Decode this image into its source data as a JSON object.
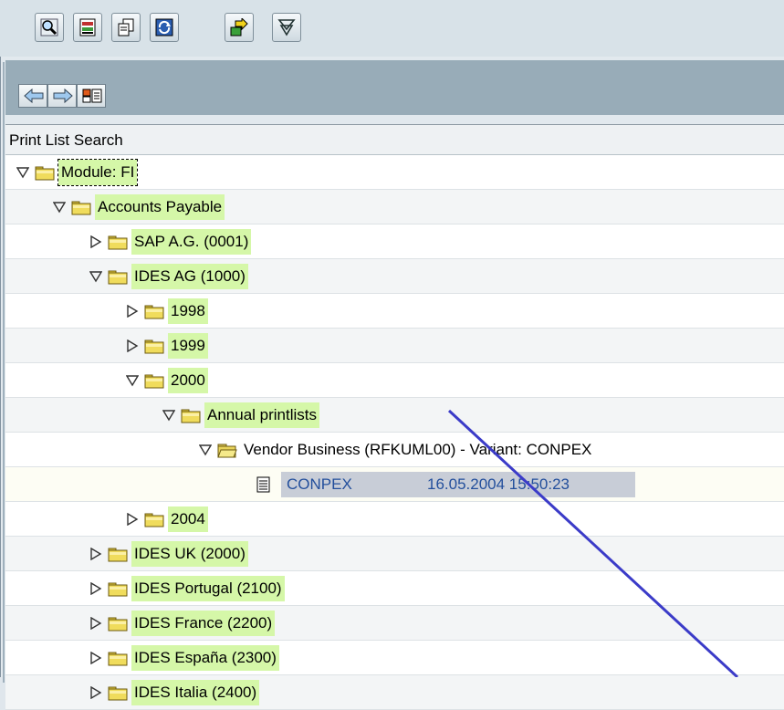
{
  "panel": {
    "header_title": "Print List Search"
  },
  "tree": [
    {
      "level": 0,
      "state": "expanded",
      "icon": "folder-icon",
      "label": "Module: FI",
      "focused": true
    },
    {
      "level": 1,
      "state": "expanded",
      "icon": "folder-icon",
      "label": "Accounts Payable"
    },
    {
      "level": 2,
      "state": "collapsed",
      "icon": "folder-icon",
      "label": "SAP A.G. (0001)"
    },
    {
      "level": 2,
      "state": "expanded",
      "icon": "folder-icon",
      "label": "IDES AG (1000)"
    },
    {
      "level": 3,
      "state": "collapsed",
      "icon": "folder-icon",
      "label": "1998"
    },
    {
      "level": 3,
      "state": "collapsed",
      "icon": "folder-icon",
      "label": "1999"
    },
    {
      "level": 3,
      "state": "expanded",
      "icon": "folder-icon",
      "label": "2000"
    },
    {
      "level": 4,
      "state": "expanded",
      "icon": "folder-icon",
      "label": "Annual printlists"
    },
    {
      "level": 5,
      "state": "expanded",
      "icon": "open-folder-icon",
      "label": "Vendor Business (RFKUML00)  -  Variant: CONPEX"
    },
    {
      "level": 6,
      "state": "leaf",
      "icon": "document-icon",
      "name": "CONPEX",
      "timestamp": "16.05.2004 15:50:23",
      "selected": true
    },
    {
      "level": 3,
      "state": "collapsed",
      "icon": "folder-icon",
      "label": "2004"
    },
    {
      "level": 2,
      "state": "collapsed",
      "icon": "folder-icon",
      "label": "IDES UK (2000)"
    },
    {
      "level": 2,
      "state": "collapsed",
      "icon": "folder-icon",
      "label": "IDES Portugal (2100)"
    },
    {
      "level": 2,
      "state": "collapsed",
      "icon": "folder-icon",
      "label": "IDES France (2200)"
    },
    {
      "level": 2,
      "state": "collapsed",
      "icon": "folder-icon",
      "label": "IDES España (2300)"
    },
    {
      "level": 2,
      "state": "collapsed",
      "icon": "folder-icon",
      "label": "IDES Italia (2400)"
    }
  ],
  "toolbar": {
    "buttons": [
      "find-icon",
      "print-layout-icon",
      "copy-pages-icon",
      "refresh-icon",
      "export-icon",
      "filter-icon"
    ]
  },
  "nav": {
    "buttons": [
      "back-arrow-icon",
      "forward-arrow-icon",
      "structure-icon"
    ]
  },
  "colors": {
    "label_highlight": "#d5f7a8",
    "selection": "#c8cdd7",
    "leaf_text": "#234f9c",
    "pointer_line": "#3b3bc8"
  }
}
